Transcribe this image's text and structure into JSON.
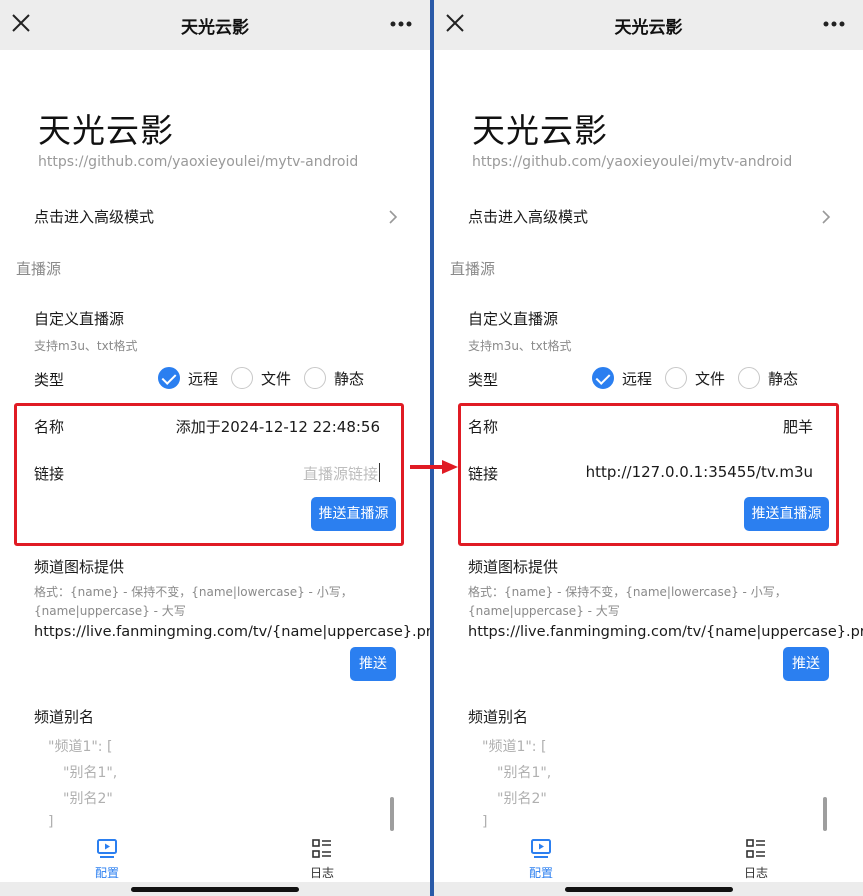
{
  "app": {
    "title": "天光云影",
    "repo": "https://github.com/yaoxieyoulei/mytv-android",
    "advanced_mode": "点击进入高级模式"
  },
  "live_source": {
    "section_label": "直播源",
    "custom_title": "自定义直播源",
    "custom_subtitle": "支持m3u、txt格式",
    "type_label": "类型",
    "type_options": [
      "远程",
      "文件",
      "静态"
    ],
    "type_selected": "远程",
    "name_label": "名称",
    "link_label": "链接",
    "push_button": "推送直播源"
  },
  "channel_logo": {
    "title": "频道图标提供",
    "format_line1": "格式：{name} - 保持不变，{name|lowercase} - 小写，",
    "format_line2": "{name|uppercase} - 大写",
    "url": "https://live.fanmingming.com/tv/{name|uppercase}.pr",
    "push_button": "推送"
  },
  "channel_alias": {
    "title": "频道别名",
    "lines": [
      "\"频道1\": [",
      "\"别名1\",",
      "\"别名2\"",
      "]"
    ]
  },
  "nav": {
    "config": "配置",
    "log": "日志"
  },
  "screens": {
    "before": {
      "name_value": "添加于2024-12-12 22:48:56",
      "link_placeholder": "直播源链接"
    },
    "after": {
      "name_value": "肥羊",
      "link_value": "http://127.0.0.1:35455/tv.m3u"
    }
  },
  "colors": {
    "accent": "#2b7ff0",
    "highlight_border": "#e01b24",
    "divider": "#2a5aa8"
  },
  "icons": [
    "close-icon",
    "more-icon",
    "chevron-right-icon",
    "check-icon",
    "config-icon",
    "log-icon",
    "arrow-right-icon"
  ]
}
